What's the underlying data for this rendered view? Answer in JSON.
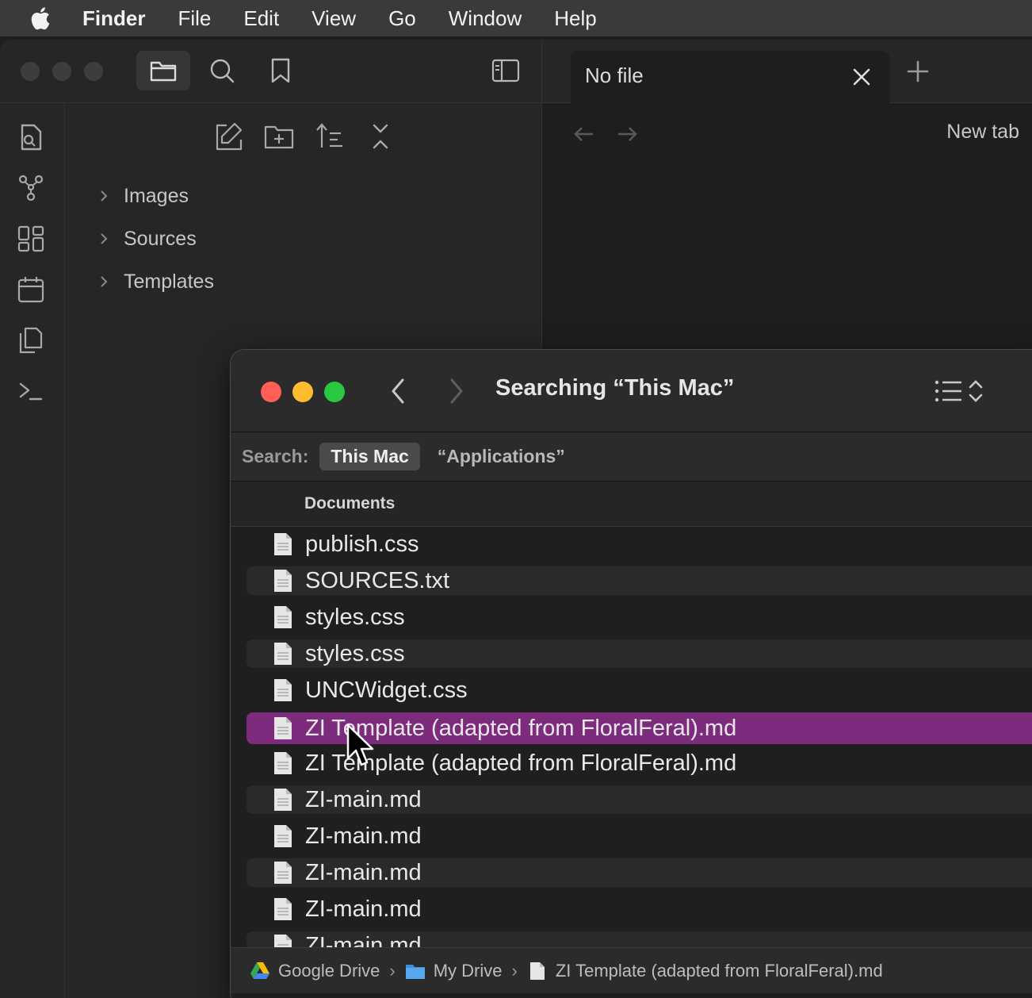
{
  "menubar": {
    "app_name": "Finder",
    "items": [
      "File",
      "Edit",
      "View",
      "Go",
      "Window",
      "Help"
    ]
  },
  "obsidian": {
    "tab_title": "No file",
    "new_tab_title": "New tab",
    "tree": [
      {
        "label": "Images"
      },
      {
        "label": "Sources"
      },
      {
        "label": "Templates"
      }
    ]
  },
  "finder": {
    "title": "Searching “This Mac”",
    "search_label": "Search:",
    "scope_active": "This Mac",
    "scope_other": "“Applications”",
    "column_header": "Documents",
    "files": [
      {
        "name": "publish.css"
      },
      {
        "name": "SOURCES.txt"
      },
      {
        "name": "styles.css"
      },
      {
        "name": "styles.css"
      },
      {
        "name": "UNCWidget.css"
      },
      {
        "name": "ZI Template (adapted from FloralFeral).md"
      },
      {
        "name": "ZI Template (adapted from FloralFeral).md"
      },
      {
        "name": "ZI-main.md"
      },
      {
        "name": "ZI-main.md"
      },
      {
        "name": "ZI-main.md"
      },
      {
        "name": "ZI-main.md"
      },
      {
        "name": "ZI-main.md"
      }
    ],
    "selected_index": 5,
    "path": [
      "Google Drive",
      "My Drive",
      "ZI Template (adapted from FloralFeral).md"
    ]
  },
  "colors": {
    "selection": "#7c2b7d",
    "close": "#ff5f57",
    "minimize": "#febc2e",
    "zoom": "#28c840"
  }
}
